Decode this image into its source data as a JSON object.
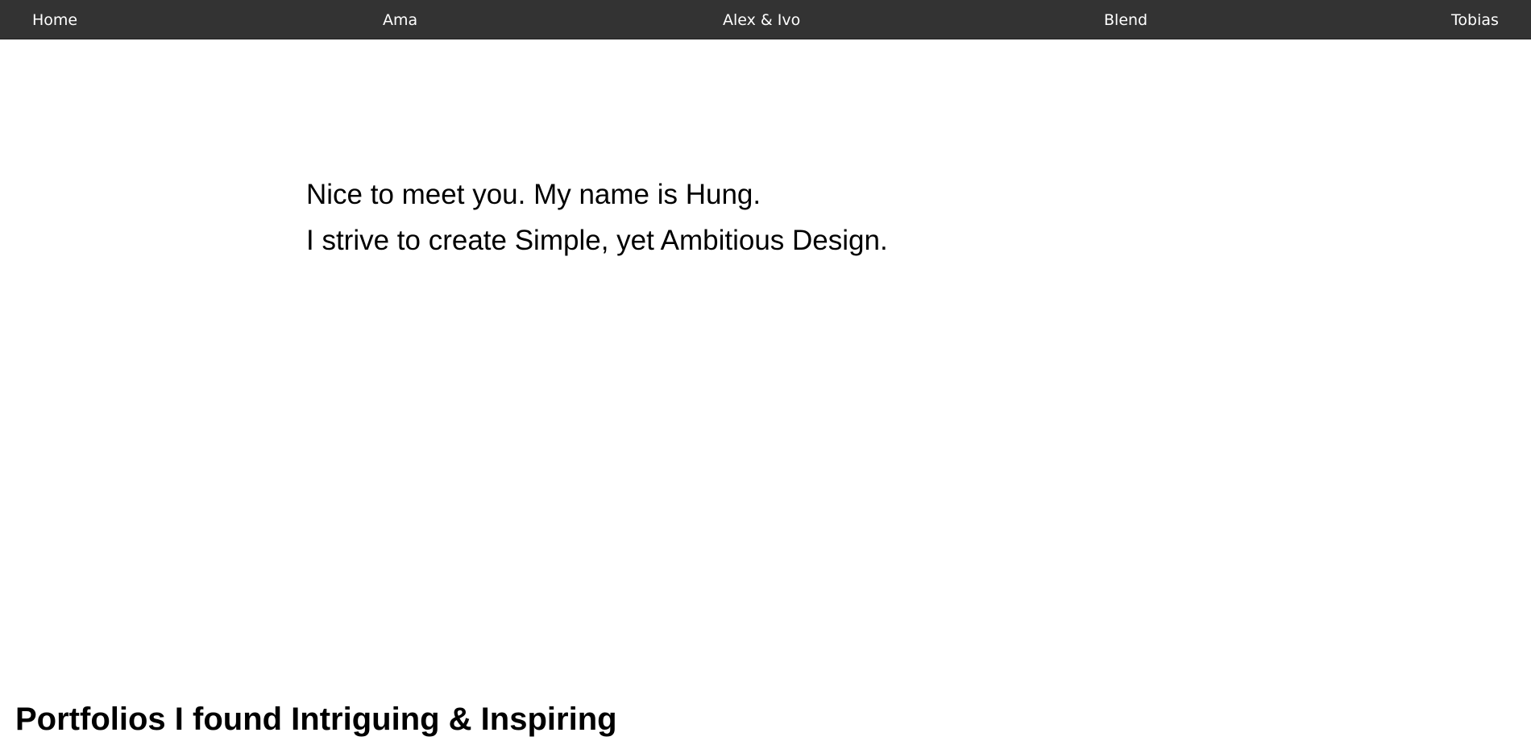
{
  "nav": {
    "items": [
      {
        "label": "Home"
      },
      {
        "label": "Ama"
      },
      {
        "label": "Alex & Ivo"
      },
      {
        "label": "Blend"
      },
      {
        "label": "Tobias"
      }
    ]
  },
  "intro": {
    "line1": "Nice to meet you. My name is Hung.",
    "line2": "I strive to create Simple, yet Ambitious Design."
  },
  "portfolios": {
    "heading": "Portfolios I found Intriguing & Inspiring"
  },
  "colors": {
    "navbar_background": "#333333",
    "nav_text": "#ffffff",
    "page_background": "#ffffff",
    "body_text": "#000000"
  }
}
